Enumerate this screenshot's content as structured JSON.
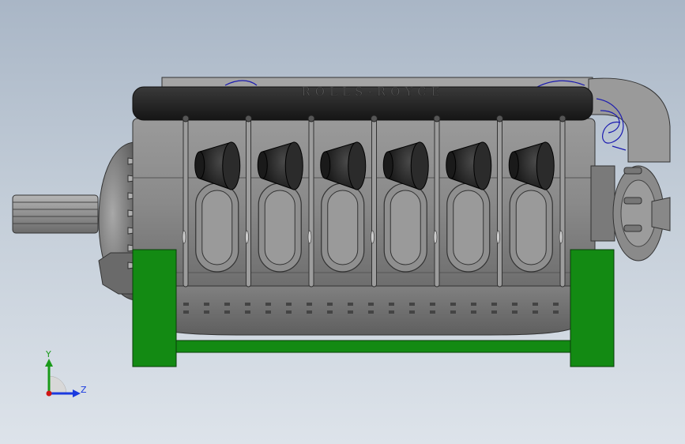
{
  "model": {
    "engine_label": "ROLLS-ROYCE",
    "cylinders_per_bank": 6
  },
  "triad": {
    "y_label": "Y",
    "z_label": "Z"
  },
  "colors": {
    "background_top": "#a9b6c6",
    "background_bottom": "#dde3ea",
    "engine_grey": "#8e8e8e",
    "cover_black": "#2a2a2a",
    "stand_green": "#138a13",
    "wiring_blue": "#1b1bb0",
    "axis_y": "#1a9a1a",
    "axis_z": "#1a3adf",
    "axis_x": "#d01515"
  }
}
